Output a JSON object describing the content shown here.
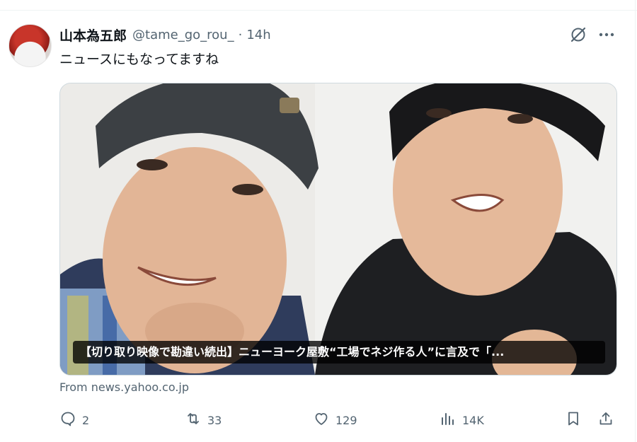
{
  "tweet": {
    "display_name": "山本為五郎",
    "handle": "@tame_go_rou_",
    "separator": "·",
    "time": "14h",
    "text": "ニュースにもなってますね"
  },
  "card": {
    "title": "【切り取り映像で勘違い続出】ニューヨーク屋敷“工場でネジ作る人”に言及で「...",
    "source": "From news.yahoo.co.jp"
  },
  "actions": {
    "replies": "2",
    "reposts": "33",
    "likes": "129",
    "views": "14K"
  },
  "icons": {
    "grok": "grok-icon",
    "more": "more-icon",
    "reply": "reply-icon",
    "repost": "repost-icon",
    "like": "heart-icon",
    "views": "views-icon",
    "bookmark": "bookmark-icon",
    "share": "share-icon"
  },
  "colors": {
    "text": "#0f1419",
    "secondary": "#536471",
    "border": "#cfd9de"
  }
}
